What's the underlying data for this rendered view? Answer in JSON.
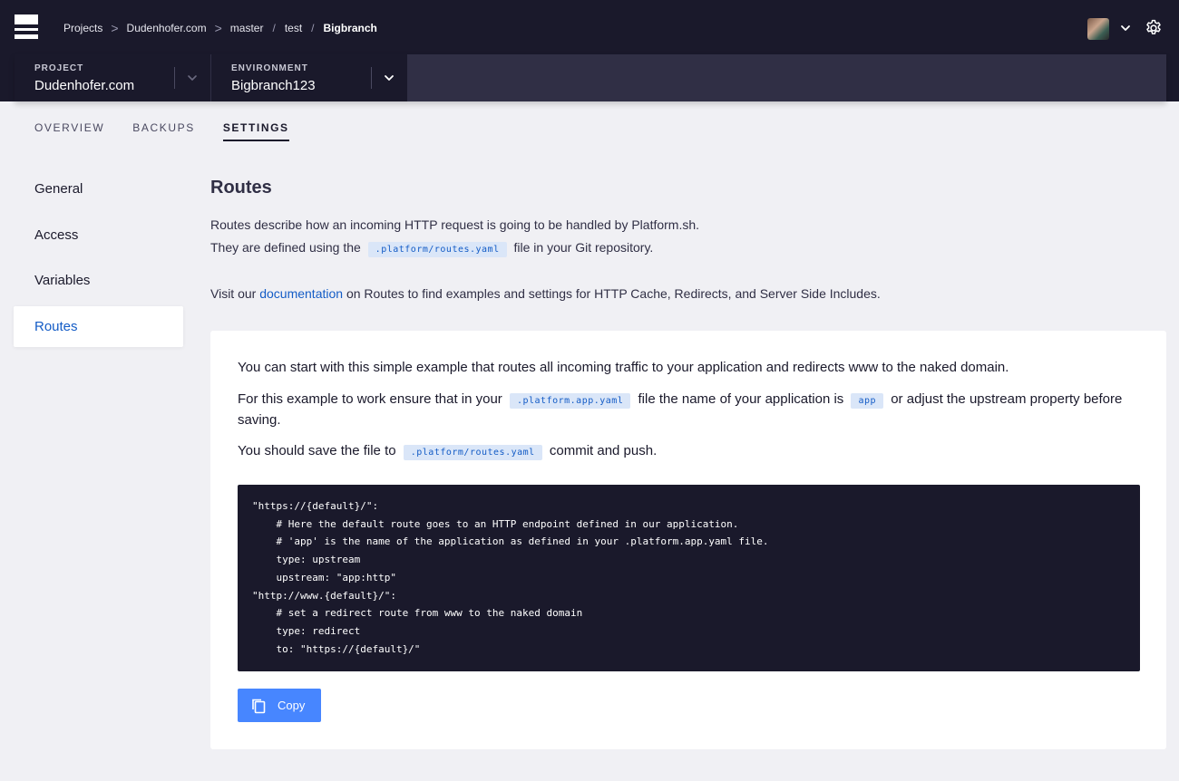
{
  "breadcrumb": {
    "items": [
      "Projects",
      "Dudenhofer.com",
      "master",
      "test",
      "Bigbranch"
    ],
    "separators": [
      ">",
      ">",
      "/",
      "/"
    ]
  },
  "project_selector": {
    "label": "PROJECT",
    "value": "Dudenhofer.com"
  },
  "environment_selector": {
    "label": "ENVIRONMENT",
    "value": "Bigbranch123"
  },
  "tabs": [
    {
      "label": "OVERVIEW",
      "active": false
    },
    {
      "label": "BACKUPS",
      "active": false
    },
    {
      "label": "SETTINGS",
      "active": true
    }
  ],
  "sidenav": {
    "items": [
      {
        "label": "General"
      },
      {
        "label": "Access"
      },
      {
        "label": "Variables"
      },
      {
        "label": "Routes",
        "active": true
      }
    ]
  },
  "main": {
    "title": "Routes",
    "desc_line1": "Routes describe how an incoming HTTP request is going to be handled by Platform.sh.",
    "desc_line2_prefix": "They are defined using the",
    "desc_line2_code": ".platform/routes.yaml",
    "desc_line2_suffix": "file in your Git repository.",
    "visit_prefix": "Visit our",
    "visit_link": "documentation",
    "visit_suffix": "on Routes to find examples and settings for HTTP Cache, Redirects, and Server Side Includes."
  },
  "card": {
    "p1": "You can start with this simple example that routes all incoming traffic to your application and redirects www to the naked domain.",
    "p2_prefix": "For this example to work ensure that in your",
    "p2_code1": ".platform.app.yaml",
    "p2_middle": "file the name of your application is",
    "p2_code2": "app",
    "p2_suffix": "or adjust the upstream property before saving.",
    "p3_prefix": "You should save the file to",
    "p3_code": ".platform/routes.yaml",
    "p3_suffix": "commit and push.",
    "code": "\"https://{default}/\":\n    # Here the default route goes to an HTTP endpoint defined in our application.\n    # 'app' is the name of the application as defined in your .platform.app.yaml file.\n    type: upstream\n    upstream: \"app:http\"\n\"http://www.{default}/\":\n    # set a redirect route from www to the naked domain\n    type: redirect\n    to: \"https://{default}/\"",
    "copy_label": "Copy"
  },
  "colors": {
    "topbar": "#1a192b",
    "accent": "#145cc6",
    "button": "#4786ff",
    "code_bg": "#1a192b"
  }
}
